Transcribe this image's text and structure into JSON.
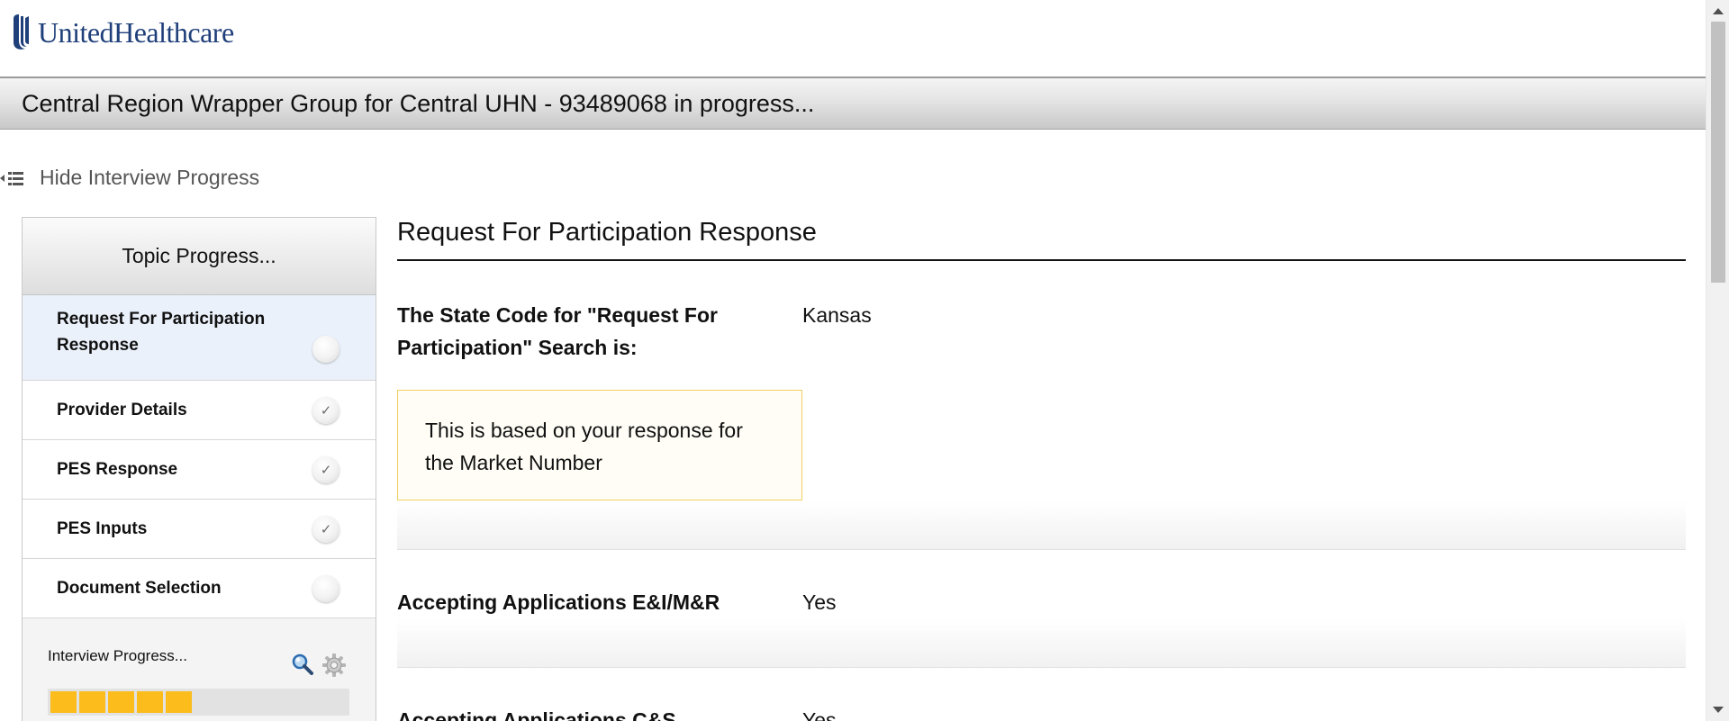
{
  "header": {
    "brand": "UnitedHealthcare",
    "title": "Central Region Wrapper Group for Central UHN - 93489068 in progress..."
  },
  "toggle": {
    "label": "Hide Interview Progress"
  },
  "sidebar": {
    "heading": "Topic Progress...",
    "topics": [
      {
        "label": "Request For Participation Response",
        "status": "current"
      },
      {
        "label": "Provider Details",
        "status": "complete",
        "mark": "✓"
      },
      {
        "label": "PES Response",
        "status": "complete",
        "mark": "✓"
      },
      {
        "label": "PES Inputs",
        "status": "complete",
        "mark": "✓"
      },
      {
        "label": "Document Selection",
        "status": "pending"
      }
    ],
    "progress": {
      "label": "Interview Progress...",
      "filled_segments": 5,
      "total_segments": 11,
      "color": "#fbbc1c"
    }
  },
  "main": {
    "section_title": "Request For Participation Response",
    "questions": [
      {
        "label": "The State Code for \"Request For Participation\" Search is:",
        "value": "Kansas"
      },
      {
        "label": "Accepting Applications E&I/M&R",
        "value": "Yes"
      },
      {
        "label": "Accepting Applications C&S",
        "value": "Yes"
      }
    ],
    "note": "This is based on your response for the Market Number"
  },
  "colors": {
    "brand": "#1f3f7a",
    "active_topic_bg": "#ebf1fa",
    "note_border": "#f2cf62"
  }
}
